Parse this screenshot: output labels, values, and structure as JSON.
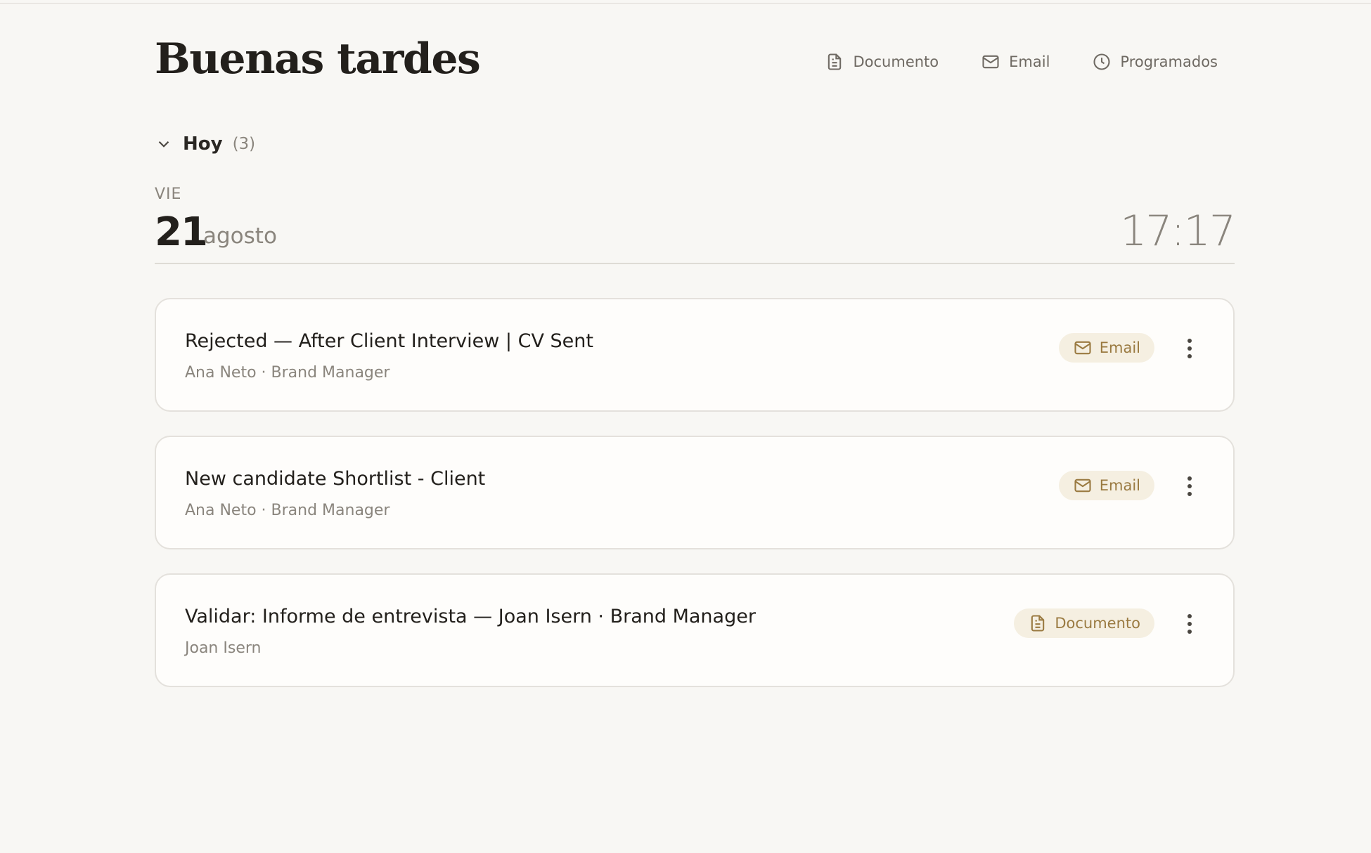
{
  "header": {
    "greeting": "Buenas tardes",
    "actions": [
      {
        "label": "Documento",
        "icon": "document-icon"
      },
      {
        "label": "Email",
        "icon": "mail-icon"
      },
      {
        "label": "Programados",
        "icon": "clock-icon"
      }
    ]
  },
  "section": {
    "title": "Hoy",
    "count": "(3)"
  },
  "date": {
    "weekday": "VIE",
    "day": "21",
    "month": "agosto",
    "time": "17:17"
  },
  "items": [
    {
      "title": "Rejected — After Client Interview | CV Sent",
      "subtitle": "Ana Neto · Brand Manager",
      "tag": "Email",
      "tag_icon": "mail-icon"
    },
    {
      "title": "New candidate Shortlist - Client",
      "subtitle": "Ana Neto · Brand Manager",
      "tag": "Email",
      "tag_icon": "mail-icon"
    },
    {
      "title": "Validar: Informe de entrevista — Joan Isern · Brand Manager",
      "subtitle": "Joan Isern",
      "tag": "Documento",
      "tag_icon": "document-icon"
    }
  ],
  "colors": {
    "background": "#f8f7f4",
    "card": "#fefdfb",
    "tag_bg": "#f5efe1",
    "tag_fg": "#9a7a41"
  }
}
